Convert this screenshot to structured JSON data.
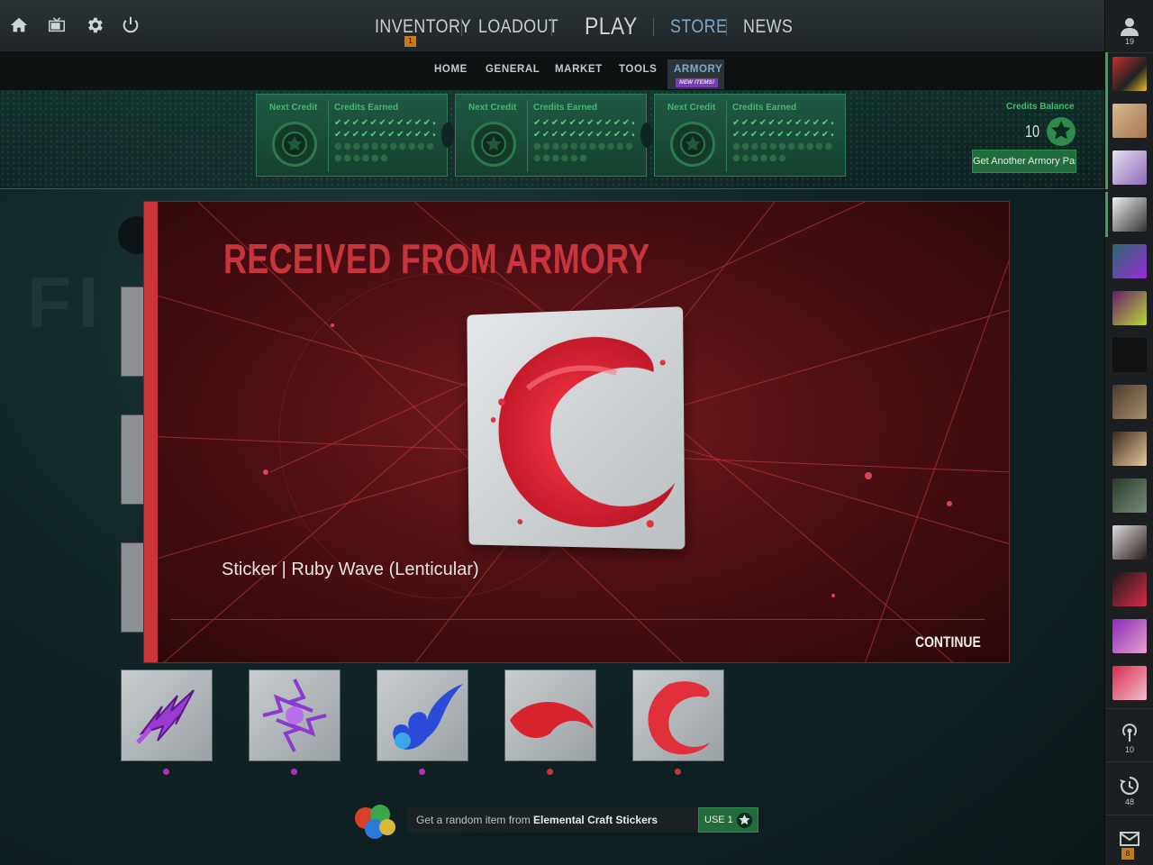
{
  "topnav": {
    "inventory": "INVENTORY",
    "inventory_badge": "1",
    "loadout": "LOADOUT",
    "play": "PLAY",
    "store": "STORE",
    "news": "NEWS"
  },
  "topicons": [
    "home-icon",
    "tv-icon",
    "gear-icon",
    "power-icon"
  ],
  "subnav": {
    "home": "HOME",
    "general": "GENERAL",
    "market": "MARKET",
    "tools": "TOOLS",
    "armory": "ARMORY",
    "armory_badge": "NEW ITEMS!"
  },
  "passes": [
    {
      "next_credit": "Next Credit",
      "credits_earned": "Credits Earned"
    },
    {
      "next_credit": "Next Credit",
      "credits_earned": "Credits Earned"
    },
    {
      "next_credit": "Next Credit",
      "credits_earned": "Credits Earned"
    }
  ],
  "balance": {
    "label": "Credits Balance",
    "value": "10",
    "get_pass": "Get Another Armory Pass"
  },
  "modal": {
    "title": "RECEIVED FROM ARMORY",
    "item_name": "Sticker | Ruby Wave (Lenticular)",
    "continue": "CONTINUE"
  },
  "collection": {
    "tiles": [
      "purple-lightning-sticker",
      "purple-swirl-sticker",
      "blue-flame-sticker",
      "red-wave-sticker",
      "ruby-wave-sticker"
    ],
    "rarity_colors": [
      "#b32fb5",
      "#b32fb5",
      "#b32fb5",
      "#c23a3a",
      "#c23a3a"
    ]
  },
  "craft": {
    "text_prefix": "Get a random item from ",
    "text_bold": "Elemental Craft Stickers",
    "use_label": "USE 1"
  },
  "sidebar": {
    "friends_count": "19",
    "broadcast_count": "10",
    "history_count": "48",
    "mail_count": "8"
  },
  "colors": {
    "accent_green": "#226b3c",
    "modal_red": "#c7343c",
    "store_blue": "#7aa9c9"
  }
}
